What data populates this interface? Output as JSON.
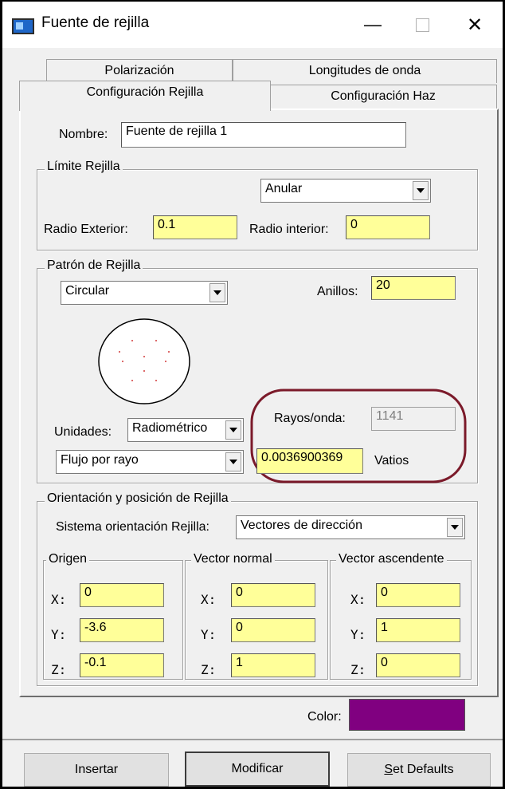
{
  "window": {
    "title": "Fuente de rejilla",
    "minimize_glyph": "—",
    "close_glyph": "✕"
  },
  "tabs": {
    "back": [
      "Polarización",
      "Longitudes de onda"
    ],
    "front": [
      "Configuración Rejilla",
      "Configuración Haz"
    ],
    "active": "Configuración Rejilla"
  },
  "nombre": {
    "label": "Nombre:",
    "value": "Fuente de rejilla 1"
  },
  "limite": {
    "legend": "Límite Rejilla",
    "shape_selected": "Anular",
    "radio_ext_label": "Radio Exterior:",
    "radio_ext_value": "0.1",
    "radio_int_label": "Radio interior:",
    "radio_int_value": "0"
  },
  "patron": {
    "legend": "Patrón de Rejilla",
    "pattern_selected": "Circular",
    "anillos_label": "Anillos:",
    "anillos_value": "20",
    "unidades_label": "Unidades:",
    "unidades_selected": "Radiométrico",
    "rayos_label": "Rayos/onda:",
    "rayos_value": "1141",
    "flujo_selected": "Flujo por rayo",
    "flujo_value": "0.0036900369",
    "flujo_unit": "Vatios",
    "highlight_color": "#7b1a2a",
    "preview_dot_color": "#d23a3a"
  },
  "orientacion": {
    "legend": "Orientación y posición de Rejilla",
    "sistema_label": "Sistema orientación Rejilla:",
    "sistema_selected": "Vectores de dirección",
    "groups": [
      {
        "legend": "Origen",
        "x": "0",
        "y": "-3.6",
        "z": "-0.1"
      },
      {
        "legend": "Vector normal",
        "x": "0",
        "y": "0",
        "z": "1"
      },
      {
        "legend": "Vector ascendente",
        "x": "0",
        "y": "1",
        "z": "0"
      }
    ],
    "axis_labels": [
      "X:",
      "Y:",
      "Z:"
    ],
    "color_label": "Color:",
    "color_value": "#800080"
  },
  "buttons": {
    "insert": "Insertar",
    "modify": "Modificar",
    "defaults_first": "S",
    "defaults_rest": "et Defaults"
  },
  "colors": {
    "field_yellow": "#ffff99",
    "dialog_bg": "#f0f0f0"
  }
}
